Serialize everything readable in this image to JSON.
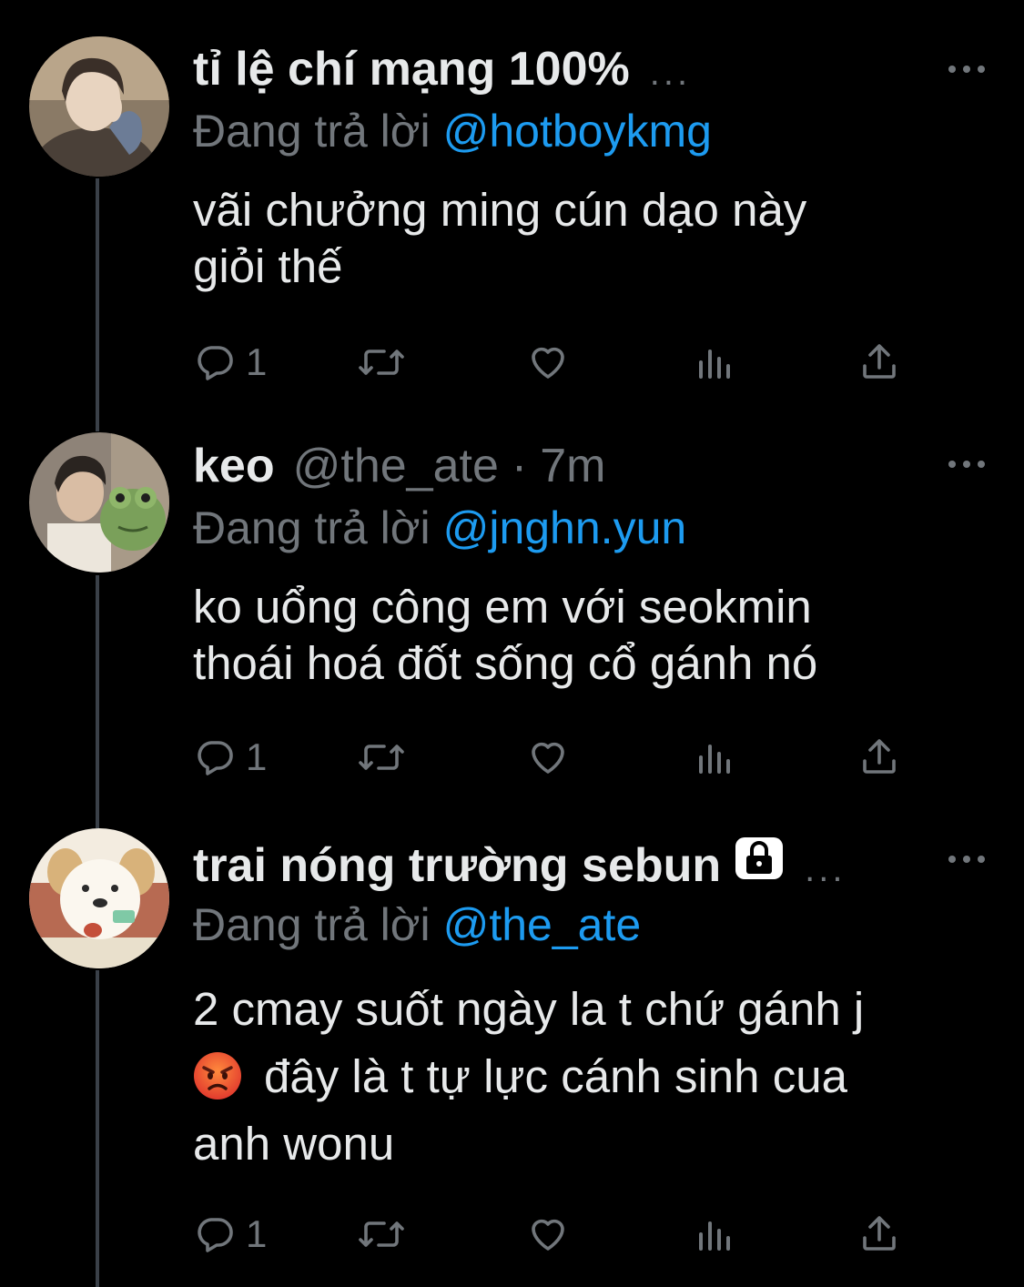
{
  "tweets": [
    {
      "name": "tỉ lệ chí mạng 100%",
      "handle": "",
      "time": "",
      "truncated": "...",
      "reply_prefix": "Đang trả lời",
      "reply_to": "@hotboykmg",
      "text_lines": [
        "vãi chưởng ming cún dạo này",
        "giỏi thế"
      ],
      "reply_count": "1",
      "avatar": "avatar-person-hand-on-face",
      "locked": false
    },
    {
      "name": "keo",
      "handle": "@the_ate",
      "dot": "·",
      "time": "7m",
      "reply_prefix": "Đang trả lời",
      "reply_to": "@jnghn.yun",
      "text_lines": [
        "ko uổng công em với seokmin",
        "thoái hoá đốt sống cổ gánh nó"
      ],
      "reply_count": "1",
      "avatar": "avatar-person-with-frog-plush",
      "locked": false
    },
    {
      "name": "trai nóng trường sebun",
      "handle": "",
      "time": "",
      "truncated": "...",
      "reply_prefix": "Đang trả lời",
      "reply_to": "@the_ate",
      "text_line1": "2 cmay suốt ngày la t chứ gánh j",
      "text_line2": "đây là t tự lực cánh sinh cua",
      "text_line3": "anh wonu",
      "emoji": "angry-face-emoji",
      "reply_count": "1",
      "avatar": "avatar-cartoon-dog",
      "locked": true
    }
  ],
  "icons": {
    "reply": "reply-icon",
    "retweet": "retweet-icon",
    "like": "heart-icon",
    "views": "views-icon",
    "share": "share-icon",
    "more": "more-icon"
  },
  "colors": {
    "background": "#000000",
    "text": "#e7e9ea",
    "muted": "#71767b",
    "accent": "#1d9bf0",
    "thread_line": "#3a4048"
  }
}
